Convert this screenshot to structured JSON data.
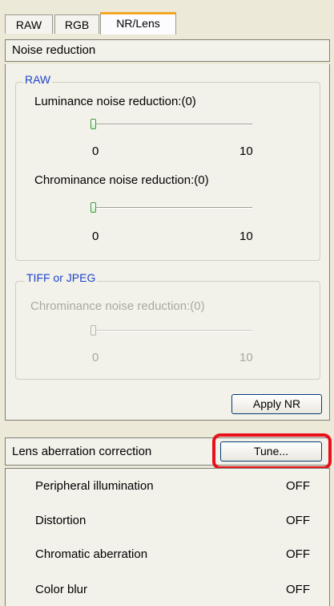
{
  "tabs": [
    {
      "label": "RAW"
    },
    {
      "label": "RGB"
    },
    {
      "label": "NR/Lens"
    }
  ],
  "noise_reduction": {
    "title": "Noise reduction",
    "raw_group": {
      "legend": "RAW",
      "luminance": {
        "label": "Luminance noise reduction:(0)",
        "min": "0",
        "max": "10",
        "value": 0
      },
      "chrominance": {
        "label": "Chrominance noise reduction:(0)",
        "min": "0",
        "max": "10",
        "value": 0
      }
    },
    "tiff_group": {
      "legend": "TIFF or JPEG",
      "chrominance": {
        "label": "Chrominance noise reduction:(0)",
        "min": "0",
        "max": "10",
        "value": 0
      }
    },
    "apply_label": "Apply NR"
  },
  "lens": {
    "title": "Lens aberration correction",
    "tune_label": "Tune...",
    "rows": [
      {
        "label": "Peripheral illumination",
        "value": "OFF"
      },
      {
        "label": "Distortion",
        "value": "OFF"
      },
      {
        "label": "Chromatic aberration",
        "value": "OFF"
      },
      {
        "label": "Color blur",
        "value": "OFF"
      }
    ]
  },
  "colors": {
    "highlight": "#e8101b",
    "legend": "#1c44c9",
    "active_tab_accent": "#f5a623"
  }
}
